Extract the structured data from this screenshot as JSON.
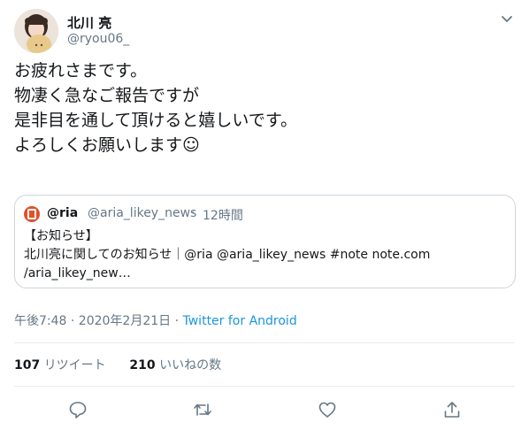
{
  "header": {
    "name": "北川 亮",
    "handle": "@ryou06_",
    "menu_icon": "chevron-down-icon"
  },
  "tweet": {
    "lines": [
      "お疲れさまです。",
      "物凄く急なご報告ですが",
      "是非目を通して頂けると嬉しいです。",
      "よろしくお願いします☺"
    ]
  },
  "quote": {
    "avatar_icon": "aria-logo-icon",
    "name": "@ria",
    "handle": "@aria_likey_news",
    "dot": "·",
    "time": "12時間",
    "body_lines": [
      "【お知らせ】",
      "北川亮に関してのお知らせ｜@ria @aria_likey_news #note note.com",
      "/aria_likey_new…"
    ]
  },
  "meta": {
    "timestamp": "午後7:48 · 2020年2月21日 · ",
    "source": "Twitter for Android"
  },
  "stats": {
    "retweets_count": "107",
    "retweets_label": "リツイート",
    "likes_count": "210",
    "likes_label": "いいねの数"
  },
  "actions": [
    "reply-icon",
    "retweet-icon",
    "like-icon",
    "share-icon"
  ],
  "colors": {
    "link": "#1b95e0",
    "secondary_text": "#657786",
    "border": "#ccd6dd",
    "quote_avatar": "#e0502a"
  }
}
